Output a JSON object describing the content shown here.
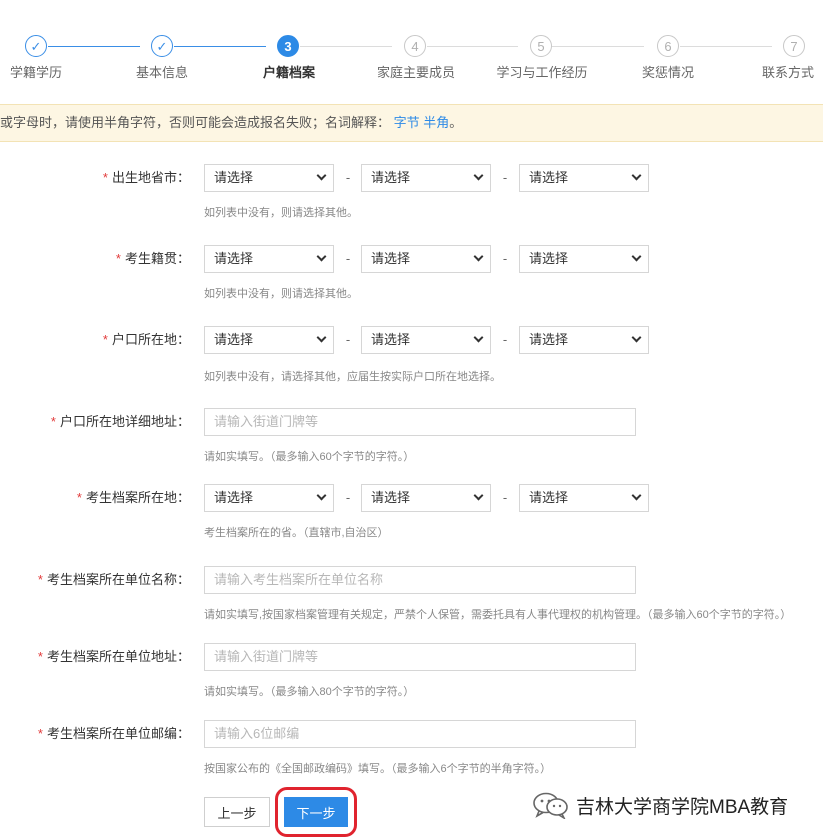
{
  "stepper": {
    "steps": [
      {
        "num": "✓",
        "label": "学籍学历",
        "state": "done"
      },
      {
        "num": "✓",
        "label": "基本信息",
        "state": "done"
      },
      {
        "num": "3",
        "label": "户籍档案",
        "state": "active"
      },
      {
        "num": "4",
        "label": "家庭主要成员",
        "state": "todo"
      },
      {
        "num": "5",
        "label": "学习与工作经历",
        "state": "todo"
      },
      {
        "num": "6",
        "label": "奖惩情况",
        "state": "todo"
      },
      {
        "num": "7",
        "label": "联系方式",
        "state": "todo"
      }
    ],
    "accent_color": "#2d8ae6"
  },
  "notice": {
    "text": "或字母时，请使用半角字符，否则可能会造成报名失败；名词解释：",
    "link1": "字节",
    "link2": "半角",
    "end": "。",
    "background_color": "#fdf6e3"
  },
  "form": {
    "birth_place": {
      "label": "出生地省市：",
      "selects": [
        "请选择",
        "请选择",
        "请选择"
      ],
      "hint": "如列表中没有，则请选择其他。"
    },
    "native_place": {
      "label": "考生籍贯：",
      "selects": [
        "请选择",
        "请选择",
        "请选择"
      ],
      "hint": "如列表中没有，则请选择其他。"
    },
    "hukou_place": {
      "label": "户口所在地：",
      "selects": [
        "请选择",
        "请选择",
        "请选择"
      ],
      "hint": "如列表中没有，请选择其他，应届生按实际户口所在地选择。"
    },
    "hukou_address": {
      "label": "户口所在地详细地址：",
      "placeholder": "请输入街道门牌等",
      "hint": "请如实填写。（最多输入60个字节的字符。）"
    },
    "archive_place": {
      "label": "考生档案所在地：",
      "selects": [
        "请选择",
        "请选择",
        "请选择"
      ],
      "hint": "考生档案所在的省。（直辖市,自治区）"
    },
    "archive_unit_name": {
      "label": "考生档案所在单位名称：",
      "placeholder": "请输入考生档案所在单位名称",
      "hint": "请如实填写,按国家档案管理有关规定，严禁个人保管，需委托具有人事代理权的机构管理。（最多输入60个字节的字符。）"
    },
    "archive_unit_address": {
      "label": "考生档案所在单位地址：",
      "placeholder": "请输入街道门牌等",
      "hint": "请如实填写。（最多输入80个字节的字符。）"
    },
    "archive_unit_zip": {
      "label": "考生档案所在单位邮编：",
      "placeholder": "请输入6位邮编",
      "hint": "按国家公布的《全国邮政编码》填写。（最多输入6个字节的半角字符。）"
    },
    "required_mark": "*"
  },
  "buttons": {
    "prev": "上一步",
    "next": "下一步",
    "highlight_color": "#e0232e"
  },
  "watermark": {
    "text": "吉林大学商学院MBA教育",
    "icon": "wechat-icon"
  }
}
